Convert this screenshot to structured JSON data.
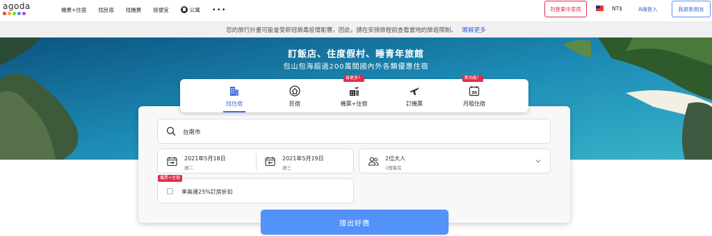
{
  "brand": {
    "name": "agoda",
    "dot_colors": [
      "#ee3a3a",
      "#f5a623",
      "#7ed321",
      "#4a90e2",
      "#b04ae2"
    ]
  },
  "nav": {
    "links": [
      "機票+住宿",
      "找民宿",
      "找機票",
      "撿便宜",
      "公寓"
    ],
    "more": "•••",
    "intl_button": "刊登東中室房",
    "currency": "NT$",
    "login": "A嗨登入",
    "register": "我是新朋友"
  },
  "notice": {
    "text": "您的旅行計畫可能會受新冠病毒疫情影響，因此，請在安排旅程前查看當地的旅遊限制。",
    "link": "瞭解更多"
  },
  "hero": {
    "title": "訂飯店、住度假村、睡青年旅館",
    "subtitle": "包山包海超過200萬間國內外各類優惠住宿"
  },
  "tabs": [
    {
      "label": "找住宿",
      "icon": "hotel-icon",
      "active": true,
      "badge": ""
    },
    {
      "label": "民宿",
      "icon": "house-icon",
      "active": false,
      "badge": ""
    },
    {
      "label": "機票+住宿",
      "icon": "flight-hotel-icon",
      "active": false,
      "badge": "省更多！"
    },
    {
      "label": "訂機票",
      "icon": "airplane-icon",
      "active": false,
      "badge": ""
    },
    {
      "label": "月租住宿",
      "icon": "calendar-30-icon",
      "active": false,
      "badge": "新功能！"
    }
  ],
  "search": {
    "destination": "台南市",
    "checkin_date": "2021年5月18日",
    "checkin_day": "週二",
    "checkout_date": "2021年5月19日",
    "checkout_day": "週三",
    "guests": "2位大人",
    "rooms": "1間客房",
    "bundle_badge": "機票+住宿",
    "bundle_label": "享高達25%訂房折扣",
    "bundle_checked": false,
    "submit": "搜出好價"
  },
  "colors": {
    "accent": "#5392f9",
    "link": "#3e6bd6",
    "badge_red": "#e12d4a"
  }
}
